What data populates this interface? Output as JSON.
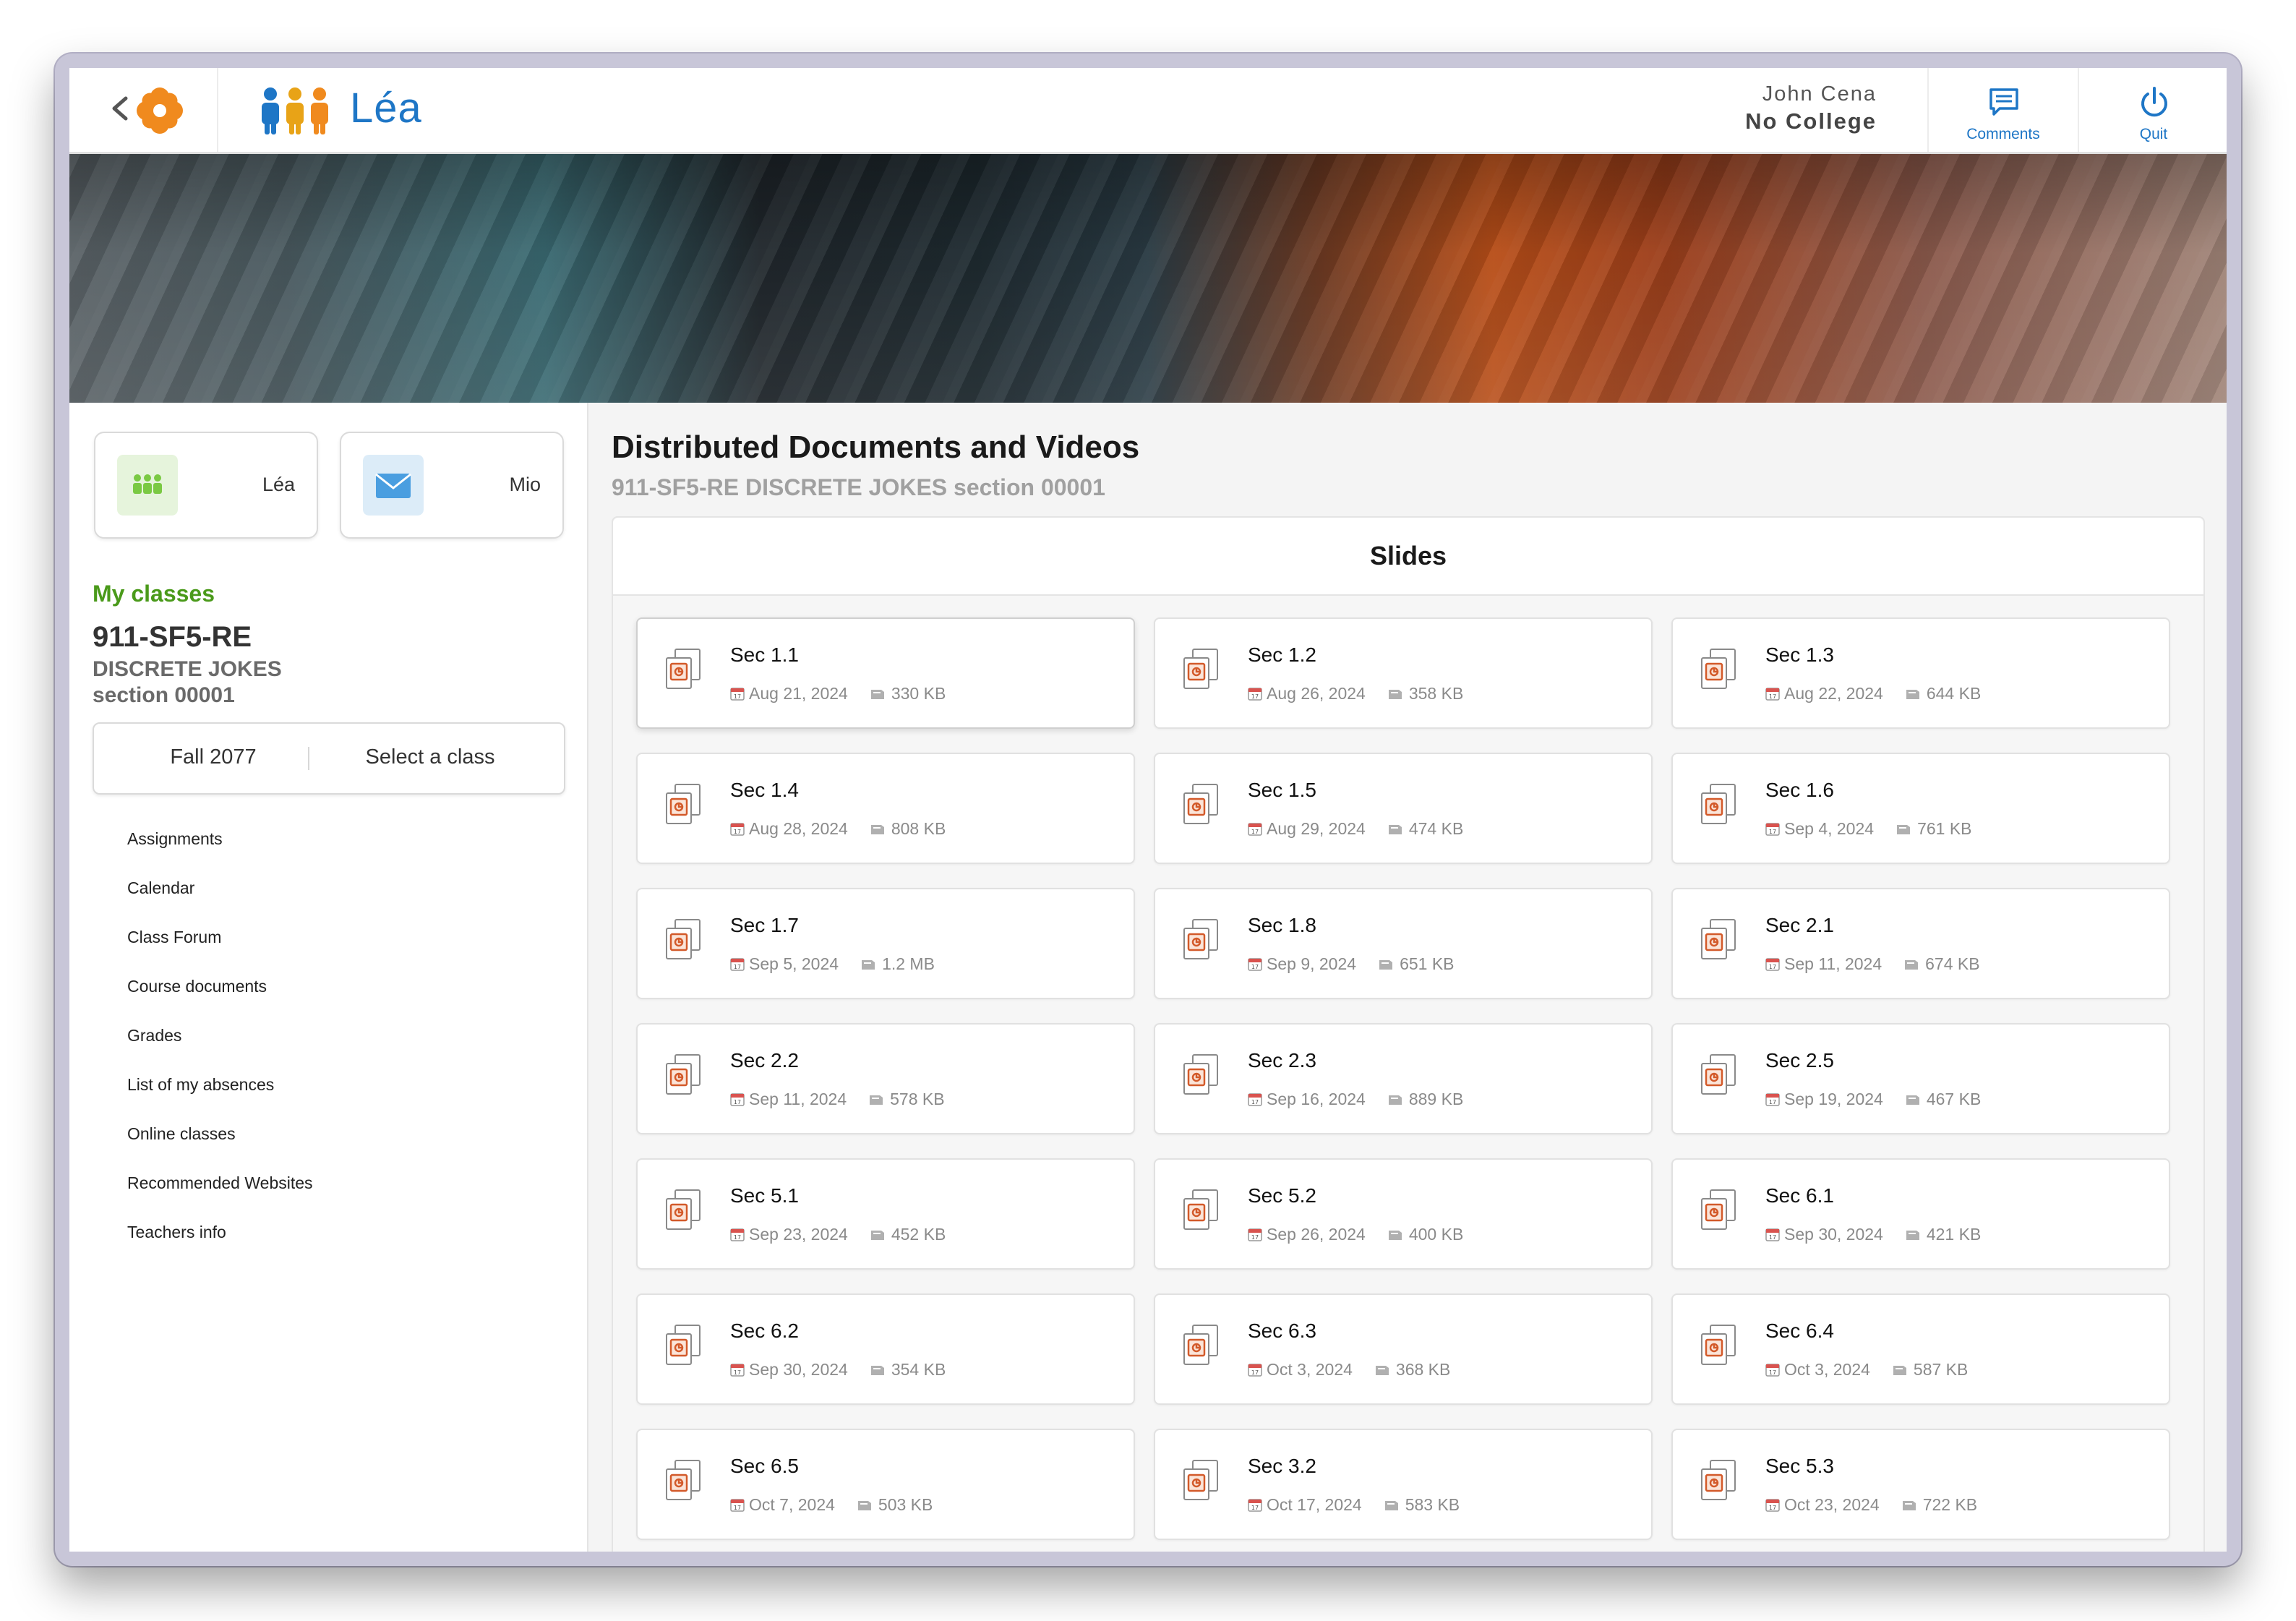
{
  "app": {
    "brand_name": "Léa",
    "user_name": "John Cena",
    "user_college": "No College",
    "buttons": {
      "comments": "Comments",
      "quit": "Quit"
    }
  },
  "sidebar": {
    "tiles": [
      {
        "label": "Léa",
        "icon": "people-icon"
      },
      {
        "label": "Mio",
        "icon": "mail-icon"
      }
    ],
    "my_classes_label": "My classes",
    "class_code": "911-SF5-RE",
    "class_name": "DISCRETE JOKES",
    "class_section": "section 00001",
    "term": "Fall 2077",
    "select_class": "Select a class",
    "nav": [
      "Assignments",
      "Calendar",
      "Class Forum",
      "Course documents",
      "Grades",
      "List of my absences",
      "Online classes",
      "Recommended Websites",
      "Teachers info"
    ]
  },
  "main": {
    "title": "Distributed Documents and Videos",
    "subtitle": "911-SF5-RE DISCRETE JOKES section 00001",
    "panel_title": "Slides",
    "documents": [
      {
        "name": "Sec 1.1",
        "date": "Aug 21, 2024",
        "size": "330 KB"
      },
      {
        "name": "Sec 1.2",
        "date": "Aug 26, 2024",
        "size": "358 KB"
      },
      {
        "name": "Sec 1.3",
        "date": "Aug 22, 2024",
        "size": "644 KB"
      },
      {
        "name": "Sec 1.4",
        "date": "Aug 28, 2024",
        "size": "808 KB"
      },
      {
        "name": "Sec 1.5",
        "date": "Aug 29, 2024",
        "size": "474 KB"
      },
      {
        "name": "Sec 1.6",
        "date": "Sep 4, 2024",
        "size": "761 KB"
      },
      {
        "name": "Sec 1.7",
        "date": "Sep 5, 2024",
        "size": "1.2 MB"
      },
      {
        "name": "Sec 1.8",
        "date": "Sep 9, 2024",
        "size": "651 KB"
      },
      {
        "name": "Sec 2.1",
        "date": "Sep 11, 2024",
        "size": "674 KB"
      },
      {
        "name": "Sec 2.2",
        "date": "Sep 11, 2024",
        "size": "578 KB"
      },
      {
        "name": "Sec 2.3",
        "date": "Sep 16, 2024",
        "size": "889 KB"
      },
      {
        "name": "Sec 2.5",
        "date": "Sep 19, 2024",
        "size": "467 KB"
      },
      {
        "name": "Sec 5.1",
        "date": "Sep 23, 2024",
        "size": "452 KB"
      },
      {
        "name": "Sec 5.2",
        "date": "Sep 26, 2024",
        "size": "400 KB"
      },
      {
        "name": "Sec 6.1",
        "date": "Sep 30, 2024",
        "size": "421 KB"
      },
      {
        "name": "Sec 6.2",
        "date": "Sep 30, 2024",
        "size": "354 KB"
      },
      {
        "name": "Sec 6.3",
        "date": "Oct 3, 2024",
        "size": "368 KB"
      },
      {
        "name": "Sec 6.4",
        "date": "Oct 3, 2024",
        "size": "587 KB"
      },
      {
        "name": "Sec 6.5",
        "date": "Oct 7, 2024",
        "size": "503 KB"
      },
      {
        "name": "Sec 3.2",
        "date": "Oct 17, 2024",
        "size": "583 KB"
      },
      {
        "name": "Sec 5.3",
        "date": "Oct 23, 2024",
        "size": "722 KB"
      }
    ]
  },
  "colors": {
    "brand_blue": "#1e76c6",
    "accent_green": "#4a9a1a",
    "file_icon_orange": "#d35a2a",
    "flower_orange": "#f08a1e"
  }
}
